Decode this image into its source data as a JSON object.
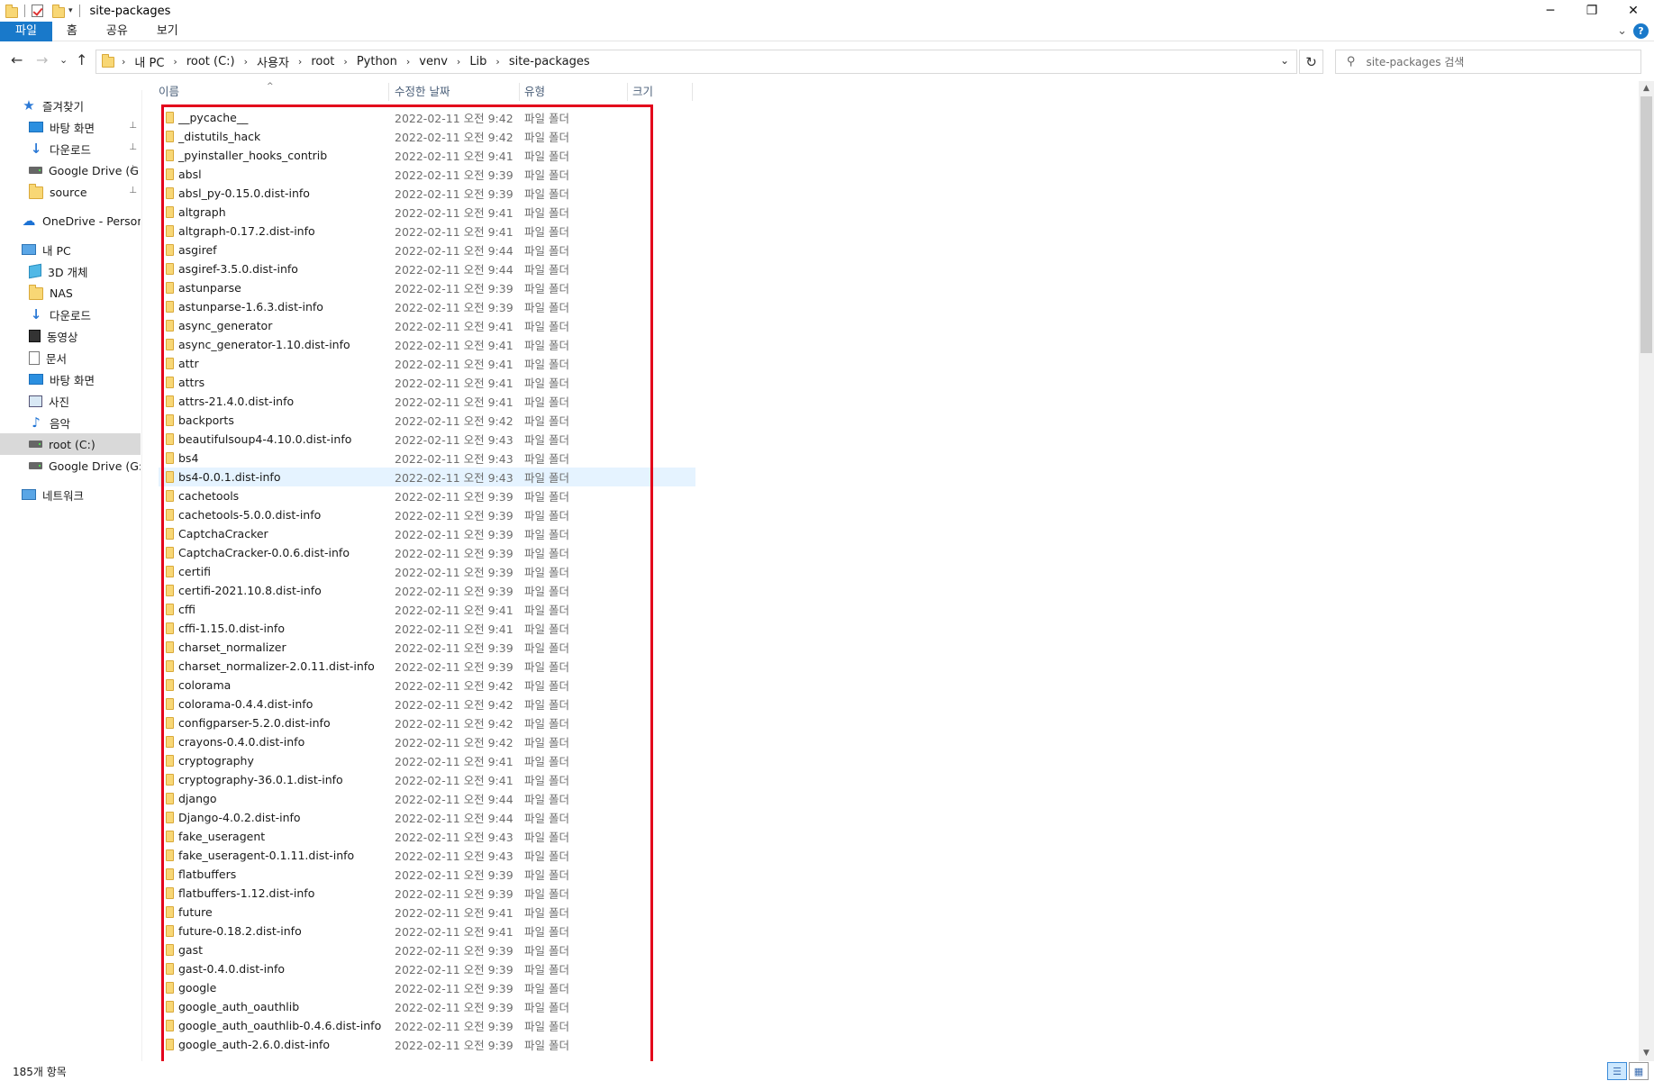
{
  "window": {
    "title": "site-packages",
    "minimize": "─",
    "maximize": "❐",
    "close": "✕"
  },
  "ribbon": {
    "tabs": [
      "파일",
      "홈",
      "공유",
      "보기"
    ],
    "collapse": "⌄",
    "help": "?"
  },
  "nav": {
    "back": "←",
    "forward": "→",
    "recent": "⌄",
    "up": "↑",
    "breadcrumb": [
      "내 PC",
      "root (C:)",
      "사용자",
      "root",
      "Python",
      "venv",
      "Lib",
      "site-packages"
    ],
    "crumb_sep": "›",
    "address_dropdown": "⌄",
    "refresh": "↻",
    "search_placeholder": "site-packages 검색"
  },
  "sidebar": {
    "items": [
      {
        "label": "즐겨찾기",
        "icon": "star-icon",
        "pinned": false
      },
      {
        "label": "바탕 화면",
        "icon": "desktop-icon",
        "pinned": true
      },
      {
        "label": "다운로드",
        "icon": "download-icon",
        "pinned": true
      },
      {
        "label": "Google Drive (G",
        "icon": "drive-icon",
        "pinned": true
      },
      {
        "label": "source",
        "icon": "folder-icon",
        "pinned": true
      },
      {
        "label": "OneDrive - Personal",
        "icon": "cloud-icon",
        "pinned": false
      },
      {
        "label": "내 PC",
        "icon": "pc-icon",
        "pinned": false
      },
      {
        "label": "3D 개체",
        "icon": "3d-objects-icon",
        "pinned": false
      },
      {
        "label": "NAS",
        "icon": "folder-icon",
        "pinned": false
      },
      {
        "label": "다운로드",
        "icon": "download-icon",
        "pinned": false
      },
      {
        "label": "동영상",
        "icon": "video-icon",
        "pinned": false
      },
      {
        "label": "문서",
        "icon": "document-icon",
        "pinned": false
      },
      {
        "label": "바탕 화면",
        "icon": "desktop-icon",
        "pinned": false
      },
      {
        "label": "사진",
        "icon": "picture-icon",
        "pinned": false
      },
      {
        "label": "음악",
        "icon": "music-icon",
        "pinned": false
      },
      {
        "label": "root (C:)",
        "icon": "drive-icon",
        "pinned": false,
        "selected": true
      },
      {
        "label": "Google Drive (G:)",
        "icon": "drive-icon",
        "pinned": false
      },
      {
        "label": "네트워크",
        "icon": "network-icon",
        "pinned": false
      }
    ],
    "pin_glyph": "📌"
  },
  "columns": {
    "name": "이름",
    "date": "수정한 날짜",
    "type": "유형",
    "size": "크기",
    "sort_glyph": "^"
  },
  "files": [
    {
      "name": "__pycache__",
      "date": "2022-02-11 오전 9:42",
      "type": "파일 폴더"
    },
    {
      "name": "_distutils_hack",
      "date": "2022-02-11 오전 9:42",
      "type": "파일 폴더"
    },
    {
      "name": "_pyinstaller_hooks_contrib",
      "date": "2022-02-11 오전 9:41",
      "type": "파일 폴더"
    },
    {
      "name": "absl",
      "date": "2022-02-11 오전 9:39",
      "type": "파일 폴더"
    },
    {
      "name": "absl_py-0.15.0.dist-info",
      "date": "2022-02-11 오전 9:39",
      "type": "파일 폴더"
    },
    {
      "name": "altgraph",
      "date": "2022-02-11 오전 9:41",
      "type": "파일 폴더"
    },
    {
      "name": "altgraph-0.17.2.dist-info",
      "date": "2022-02-11 오전 9:41",
      "type": "파일 폴더"
    },
    {
      "name": "asgiref",
      "date": "2022-02-11 오전 9:44",
      "type": "파일 폴더"
    },
    {
      "name": "asgiref-3.5.0.dist-info",
      "date": "2022-02-11 오전 9:44",
      "type": "파일 폴더"
    },
    {
      "name": "astunparse",
      "date": "2022-02-11 오전 9:39",
      "type": "파일 폴더"
    },
    {
      "name": "astunparse-1.6.3.dist-info",
      "date": "2022-02-11 오전 9:39",
      "type": "파일 폴더"
    },
    {
      "name": "async_generator",
      "date": "2022-02-11 오전 9:41",
      "type": "파일 폴더"
    },
    {
      "name": "async_generator-1.10.dist-info",
      "date": "2022-02-11 오전 9:41",
      "type": "파일 폴더"
    },
    {
      "name": "attr",
      "date": "2022-02-11 오전 9:41",
      "type": "파일 폴더"
    },
    {
      "name": "attrs",
      "date": "2022-02-11 오전 9:41",
      "type": "파일 폴더"
    },
    {
      "name": "attrs-21.4.0.dist-info",
      "date": "2022-02-11 오전 9:41",
      "type": "파일 폴더"
    },
    {
      "name": "backports",
      "date": "2022-02-11 오전 9:42",
      "type": "파일 폴더"
    },
    {
      "name": "beautifulsoup4-4.10.0.dist-info",
      "date": "2022-02-11 오전 9:43",
      "type": "파일 폴더"
    },
    {
      "name": "bs4",
      "date": "2022-02-11 오전 9:43",
      "type": "파일 폴더"
    },
    {
      "name": "bs4-0.0.1.dist-info",
      "date": "2022-02-11 오전 9:43",
      "type": "파일 폴더",
      "hover": true
    },
    {
      "name": "cachetools",
      "date": "2022-02-11 오전 9:39",
      "type": "파일 폴더"
    },
    {
      "name": "cachetools-5.0.0.dist-info",
      "date": "2022-02-11 오전 9:39",
      "type": "파일 폴더"
    },
    {
      "name": "CaptchaCracker",
      "date": "2022-02-11 오전 9:39",
      "type": "파일 폴더"
    },
    {
      "name": "CaptchaCracker-0.0.6.dist-info",
      "date": "2022-02-11 오전 9:39",
      "type": "파일 폴더"
    },
    {
      "name": "certifi",
      "date": "2022-02-11 오전 9:39",
      "type": "파일 폴더"
    },
    {
      "name": "certifi-2021.10.8.dist-info",
      "date": "2022-02-11 오전 9:39",
      "type": "파일 폴더"
    },
    {
      "name": "cffi",
      "date": "2022-02-11 오전 9:41",
      "type": "파일 폴더"
    },
    {
      "name": "cffi-1.15.0.dist-info",
      "date": "2022-02-11 오전 9:41",
      "type": "파일 폴더"
    },
    {
      "name": "charset_normalizer",
      "date": "2022-02-11 오전 9:39",
      "type": "파일 폴더"
    },
    {
      "name": "charset_normalizer-2.0.11.dist-info",
      "date": "2022-02-11 오전 9:39",
      "type": "파일 폴더"
    },
    {
      "name": "colorama",
      "date": "2022-02-11 오전 9:42",
      "type": "파일 폴더"
    },
    {
      "name": "colorama-0.4.4.dist-info",
      "date": "2022-02-11 오전 9:42",
      "type": "파일 폴더"
    },
    {
      "name": "configparser-5.2.0.dist-info",
      "date": "2022-02-11 오전 9:42",
      "type": "파일 폴더"
    },
    {
      "name": "crayons-0.4.0.dist-info",
      "date": "2022-02-11 오전 9:42",
      "type": "파일 폴더"
    },
    {
      "name": "cryptography",
      "date": "2022-02-11 오전 9:41",
      "type": "파일 폴더"
    },
    {
      "name": "cryptography-36.0.1.dist-info",
      "date": "2022-02-11 오전 9:41",
      "type": "파일 폴더"
    },
    {
      "name": "django",
      "date": "2022-02-11 오전 9:44",
      "type": "파일 폴더"
    },
    {
      "name": "Django-4.0.2.dist-info",
      "date": "2022-02-11 오전 9:44",
      "type": "파일 폴더"
    },
    {
      "name": "fake_useragent",
      "date": "2022-02-11 오전 9:43",
      "type": "파일 폴더"
    },
    {
      "name": "fake_useragent-0.1.11.dist-info",
      "date": "2022-02-11 오전 9:43",
      "type": "파일 폴더"
    },
    {
      "name": "flatbuffers",
      "date": "2022-02-11 오전 9:39",
      "type": "파일 폴더"
    },
    {
      "name": "flatbuffers-1.12.dist-info",
      "date": "2022-02-11 오전 9:39",
      "type": "파일 폴더"
    },
    {
      "name": "future",
      "date": "2022-02-11 오전 9:41",
      "type": "파일 폴더"
    },
    {
      "name": "future-0.18.2.dist-info",
      "date": "2022-02-11 오전 9:41",
      "type": "파일 폴더"
    },
    {
      "name": "gast",
      "date": "2022-02-11 오전 9:39",
      "type": "파일 폴더"
    },
    {
      "name": "gast-0.4.0.dist-info",
      "date": "2022-02-11 오전 9:39",
      "type": "파일 폴더"
    },
    {
      "name": "google",
      "date": "2022-02-11 오전 9:39",
      "type": "파일 폴더"
    },
    {
      "name": "google_auth_oauthlib",
      "date": "2022-02-11 오전 9:39",
      "type": "파일 폴더"
    },
    {
      "name": "google_auth_oauthlib-0.4.6.dist-info",
      "date": "2022-02-11 오전 9:39",
      "type": "파일 폴더"
    },
    {
      "name": "google_auth-2.6.0.dist-info",
      "date": "2022-02-11 오전 9:39",
      "type": "파일 폴더"
    }
  ],
  "status": {
    "item_count": "185개 항목"
  },
  "colors": {
    "accent": "#1979ca",
    "highlight_box": "#e3001b",
    "hover_row": "#e5f3ff",
    "folder": "#f8d775"
  }
}
